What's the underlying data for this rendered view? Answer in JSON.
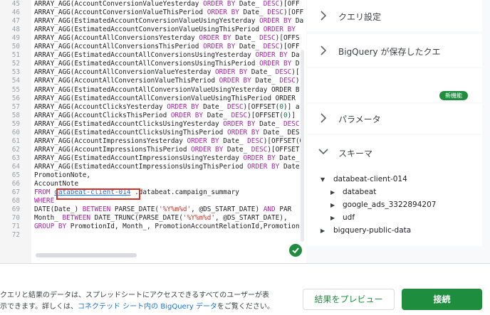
{
  "editor": {
    "lines": [
      {
        "n": "45",
        "t": "ARRAY_AGG(AccountConversionValueYesterday ORDER BY Date_ DESC)[OFF"
      },
      {
        "n": "46",
        "t": "ARRAY_AGG(AccountConversionValueThisPeriod ORDER BY Date_ DESC)[OFF"
      },
      {
        "n": "47",
        "t": "ARRAY_AGG(EstimatedAccountConversionValueUsingYesterday ORDER BY Da"
      },
      {
        "n": "48",
        "t": "ARRAY_AGG(EstimatedAccountConversionValueUsingThisPeriod ORDER BY "
      },
      {
        "n": "49",
        "t": "ARRAY_AGG(AccountAllConversionsYesterday ORDER BY Date_ DESC)[OFFS"
      },
      {
        "n": "50",
        "t": "ARRAY_AGG(AccountAllConversionsThisPeriod ORDER BY Date_ DESC)[OFF"
      },
      {
        "n": "51",
        "t": "ARRAY_AGG(EstimatedAccountAllConversionsUsingYesterday ORDER BY Da"
      },
      {
        "n": "52",
        "t": "ARRAY_AGG(EstimatedAccountAllConversionsUsingThisPeriod ORDER BY D"
      },
      {
        "n": "53",
        "t": "ARRAY_AGG(AccountAllConversionValueYesterday ORDER BY Date_ DESC)["
      },
      {
        "n": "54",
        "t": "ARRAY_AGG(AccountAllConversionValueThisPeriod ORDER BY Date_ DESC)"
      },
      {
        "n": "55",
        "t": "ARRAY_AGG(EstimatedAccountAllConversionValueUsingYesterday ORDER B"
      },
      {
        "n": "56",
        "t": "ARRAY_AGG(EstimatedAccountAllConversionValueUsingThisPeriod ORDER "
      },
      {
        "n": "57",
        "t": "ARRAY_AGG(AccountClicksYesterday ORDER BY Date_ DESC)[OFFSET(0)] a"
      },
      {
        "n": "58",
        "t": "ARRAY_AGG(AccountClicksThisPeriod ORDER BY Date_ DESC)[OFFSET(0)] "
      },
      {
        "n": "59",
        "t": "ARRAY_AGG(EstimatedAccountClicksUsingYesterday ORDER BY Date_ DESC"
      },
      {
        "n": "60",
        "t": "ARRAY_AGG(EstimatedAccountClicksUsingThisPeriod ORDER BY Date_ DES"
      },
      {
        "n": "61",
        "t": "ARRAY_AGG(AccountImpressionsYesterday ORDER BY Date_ DESC)[OFFSET(0"
      },
      {
        "n": "62",
        "t": "ARRAY_AGG(AccountImpressionsThisPeriod ORDER BY Date_ DESC)[OFFSET"
      },
      {
        "n": "63",
        "t": "ARRAY_AGG(EstimatedAccountImpressionsUsingYesterday ORDER BY Date_"
      },
      {
        "n": "64",
        "t": "ARRAY_AGG(EstimatedAccountImpressionsUsingThisPeriod ORDER BY Date"
      },
      {
        "n": "65",
        "t": "PromotionNote,"
      },
      {
        "n": "66",
        "t": "AccountNote"
      },
      {
        "n": "67",
        "t": "FROM databeat-client-014 .databeat.campaign_summary"
      },
      {
        "n": "68",
        "t": "WHERE"
      },
      {
        "n": "69",
        "t": "DATE(Date_) BETWEEN PARSE_DATE('%Y%m%d', @DS_START_DATE) AND PAR"
      },
      {
        "n": "70",
        "t": "Month_ BETWEEN DATE_TRUNC(PARSE_DATE('%Y%m%d', @DS_START_DATE), "
      },
      {
        "n": "71",
        "t": "GROUP BY PromotionId, Month_, PromotionAccountRelationId,Promotion"
      },
      {
        "n": "72",
        "t": ""
      }
    ]
  },
  "panel": {
    "sections": {
      "query_settings": "クエリ設定",
      "saved_queries": "BigQuery が保存したクエ",
      "parameters": "パラメータ",
      "schema": "スキーマ"
    },
    "new_badge": "新機能",
    "tree": {
      "project": "databeat-client-014",
      "datasets": [
        "databeat",
        "google_ads_3322894207",
        "udf"
      ],
      "public": "bigquery-public-data"
    }
  },
  "footer": {
    "note_line1": "クエリと結果のデータは、スプレッドシートにアクセスできるすべてのユーザーが表",
    "note_line2_prefix": "示できます。詳しくは、",
    "note_link": "コネクテッド シート内の BigQuery データ",
    "note_line2_suffix": "をご覧ください。",
    "preview_label": "結果をプレビュー",
    "connect_label": "接続"
  },
  "colors": {
    "accent": "#1e8e3e",
    "highlight_box": "#d93025",
    "keyword": "#a626a4",
    "string": "#c0392b",
    "link": "#1a73e8"
  }
}
